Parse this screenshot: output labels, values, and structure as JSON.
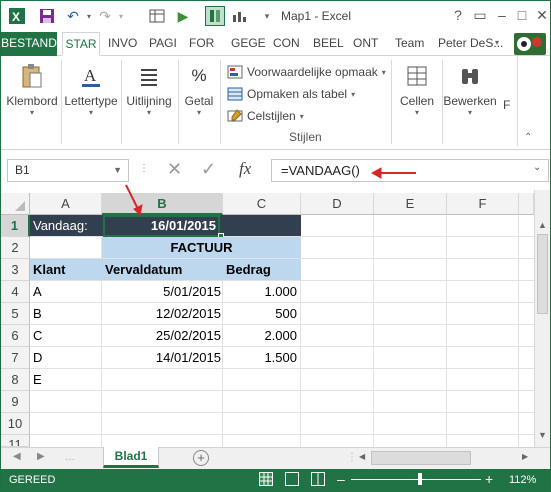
{
  "window": {
    "title": "Map1 - Excel"
  },
  "tabs": {
    "file": "BESTAND",
    "home": "STAR",
    "insert": "INVO",
    "page": "PAGI",
    "formulas": "FOR",
    "data": "GEGE",
    "review": "CON",
    "view": "BEEL",
    "developer": "ONT",
    "team": "Team",
    "user": "Peter DeS..."
  },
  "ribbon": {
    "clipboard": "Klembord",
    "font": "Lettertype",
    "alignment": "Uitlijning",
    "number": "Getal",
    "cond_format": "Voorwaardelijke opmaak",
    "format_table": "Opmaken als tabel",
    "cell_styles": "Celstijlen",
    "styles_group": "Stijlen",
    "cells": "Cellen",
    "editing": "Bewerken",
    "more": "F"
  },
  "formula_bar": {
    "name_box": "B1",
    "fx": "fx",
    "formula": "=VANDAAG()"
  },
  "grid": {
    "columns": [
      "A",
      "B",
      "C",
      "D",
      "E",
      "F"
    ],
    "rows": [
      "1",
      "2",
      "3",
      "4",
      "5",
      "6",
      "7",
      "8",
      "9",
      "10",
      "11"
    ],
    "r1_label": "Vandaag:",
    "r1_date": "16/01/2015",
    "title": "FACTUUR",
    "headers": {
      "client": "Klant",
      "due": "Vervaldatum",
      "amount": "Bedrag"
    },
    "data": [
      {
        "client": "A",
        "due": "5/01/2015",
        "amount": "1.000"
      },
      {
        "client": "B",
        "due": "12/02/2015",
        "amount": "500"
      },
      {
        "client": "C",
        "due": "25/02/2015",
        "amount": "2.000"
      },
      {
        "client": "D",
        "due": "14/01/2015",
        "amount": "1.500"
      },
      {
        "client": "E",
        "due": "",
        "amount": ""
      }
    ]
  },
  "sheets": {
    "active": "Blad1"
  },
  "status": {
    "ready": "GEREED",
    "zoom": "112%"
  },
  "colors": {
    "accent": "#217346",
    "dark_cell": "#323f4f",
    "blue_cell": "#bdd7ee",
    "arrow": "#d8262b"
  }
}
